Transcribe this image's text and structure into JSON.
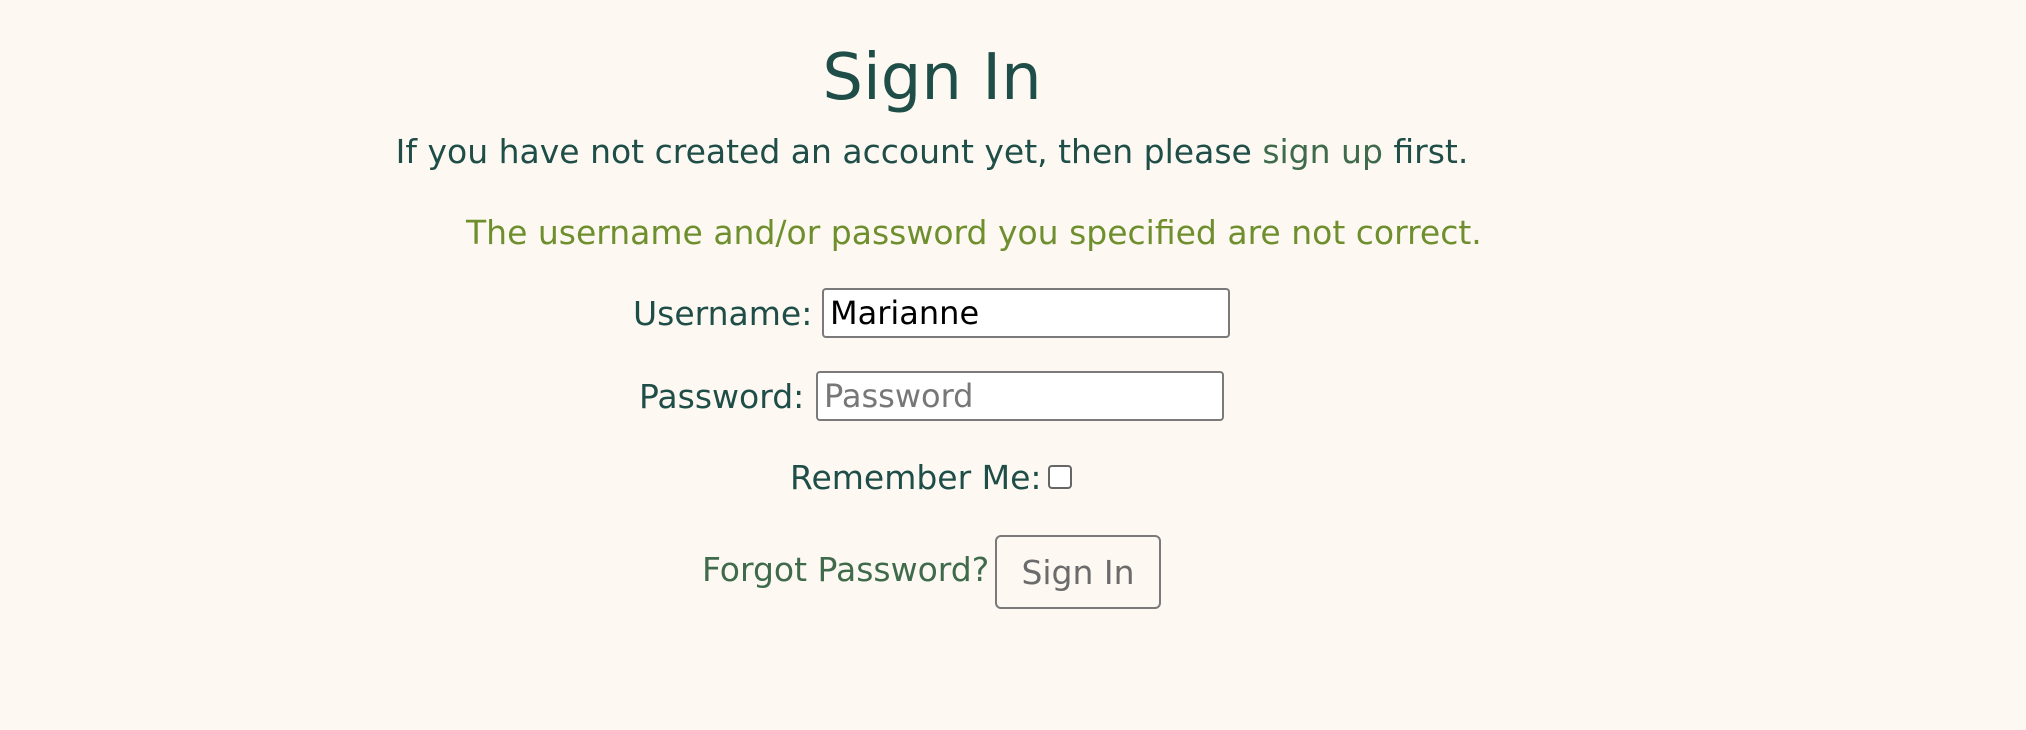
{
  "page": {
    "title": "Sign In",
    "intro_prefix": "If you have not created an account yet, then please ",
    "signup_link": "sign up",
    "intro_suffix": " first.",
    "error_message": "The username and/or password you specified are not correct."
  },
  "form": {
    "username_label": "Username:",
    "username_value": "Marianne",
    "password_label": "Password:",
    "password_placeholder": "Password",
    "remember_label": "Remember Me:",
    "remember_checked": false,
    "forgot_link": "Forgot Password?",
    "submit_label": "Sign In"
  },
  "colors": {
    "background": "#fdf9f2",
    "text": "#1f4d47",
    "link": "#3f6b4c",
    "error": "#6f8f2f"
  }
}
